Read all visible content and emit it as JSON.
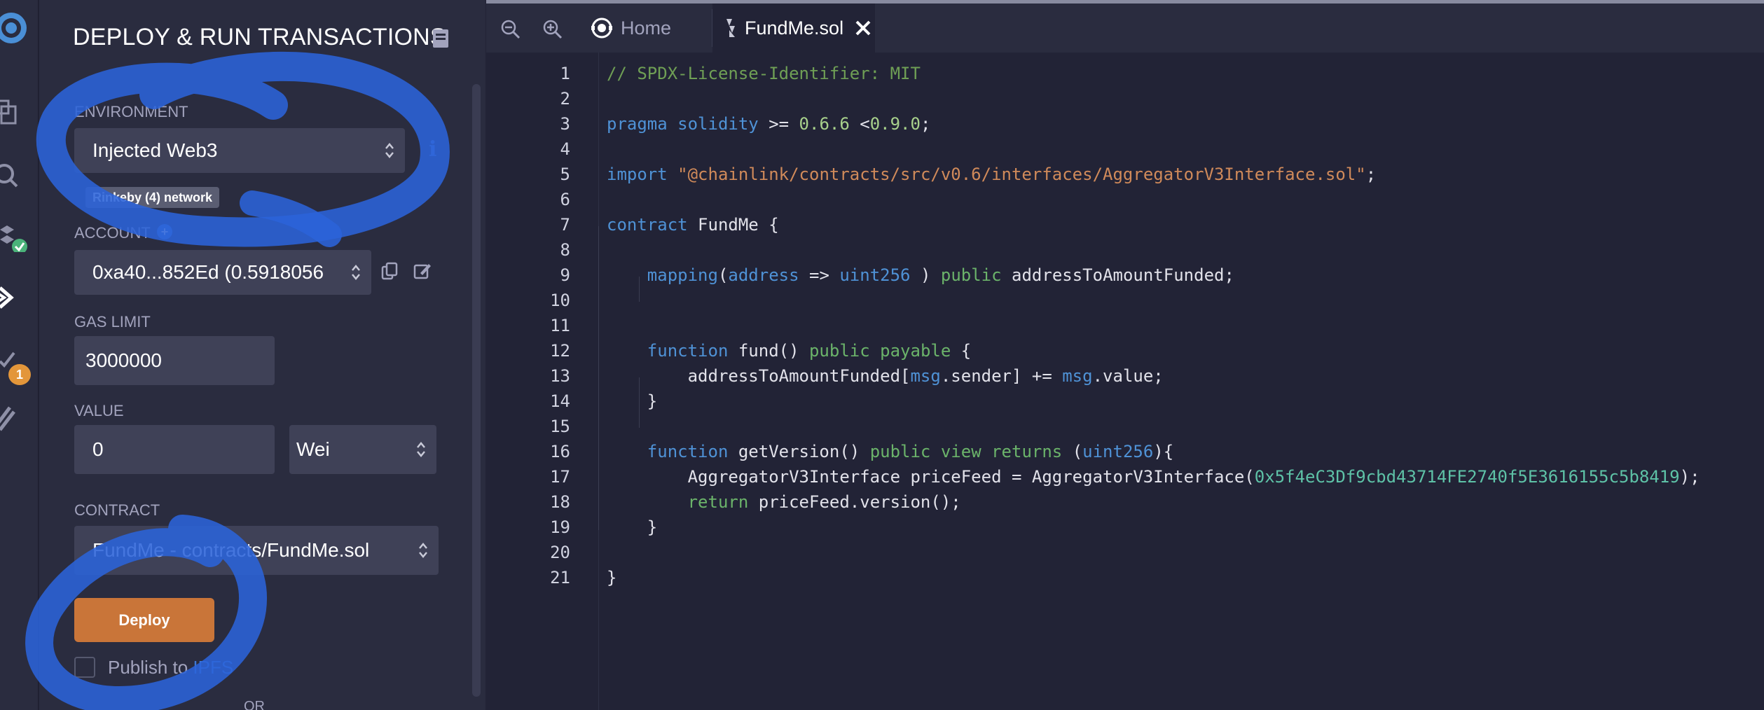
{
  "panel": {
    "title": "DEPLOY & RUN TRANSACTIONS",
    "environment": {
      "label": "ENVIRONMENT",
      "value": "Injected Web3",
      "network_tooltip": "Rinkeby (4) network"
    },
    "account": {
      "label": "ACCOUNT",
      "value": "0xa40...852Ed (0.5918056"
    },
    "gas_limit": {
      "label": "GAS LIMIT",
      "value": "3000000"
    },
    "value": {
      "label": "VALUE",
      "amount": "0",
      "unit": "Wei"
    },
    "contract": {
      "label": "CONTRACT",
      "value": "FundMe - contracts/FundMe.sol"
    },
    "deploy_label": "Deploy",
    "publish_prefix": "Publish to ",
    "publish_link": "IPFS",
    "or_label": "OR"
  },
  "rail": {
    "badge_count": "1"
  },
  "editor": {
    "tabs": [
      {
        "label": "Home",
        "icon": "remix-logo-icon"
      },
      {
        "label": "FundMe.sol",
        "icon": "solidity-file-icon"
      }
    ],
    "code_lines": [
      [
        {
          "t": "// SPDX-License-Identifier: MIT",
          "c": "com"
        }
      ],
      [],
      [
        {
          "t": "pragma",
          "c": "kw"
        },
        {
          "t": " "
        },
        {
          "t": "solidity",
          "c": "kw"
        },
        {
          "t": " >= "
        },
        {
          "t": "0.6.6",
          "c": "num"
        },
        {
          "t": " <"
        },
        {
          "t": "0.9.0",
          "c": "num"
        },
        {
          "t": ";"
        }
      ],
      [],
      [
        {
          "t": "import",
          "c": "kw"
        },
        {
          "t": " "
        },
        {
          "t": "\"@chainlink/contracts/src/v0.6/interfaces/AggregatorV3Interface.sol\"",
          "c": "str"
        },
        {
          "t": ";"
        }
      ],
      [],
      [
        {
          "t": "contract",
          "c": "kw"
        },
        {
          "t": " FundMe {"
        }
      ],
      [],
      [
        {
          "t": "    "
        },
        {
          "t": "mapping",
          "c": "kw"
        },
        {
          "t": "("
        },
        {
          "t": "address",
          "c": "type"
        },
        {
          "t": " => "
        },
        {
          "t": "uint256",
          "c": "type"
        },
        {
          "t": " ) "
        },
        {
          "t": "public",
          "c": "kw2"
        },
        {
          "t": " addressToAmountFunded;"
        }
      ],
      [],
      [],
      [
        {
          "t": "    "
        },
        {
          "t": "function",
          "c": "kw"
        },
        {
          "t": " fund() "
        },
        {
          "t": "public",
          "c": "kw2"
        },
        {
          "t": " "
        },
        {
          "t": "payable",
          "c": "kw2"
        },
        {
          "t": " {"
        }
      ],
      [
        {
          "t": "        addressToAmountFunded["
        },
        {
          "t": "msg",
          "c": "kw"
        },
        {
          "t": ".sender] += "
        },
        {
          "t": "msg",
          "c": "kw"
        },
        {
          "t": ".value;"
        }
      ],
      [
        {
          "t": "    }"
        }
      ],
      [],
      [
        {
          "t": "    "
        },
        {
          "t": "function",
          "c": "kw"
        },
        {
          "t": " getVersion() "
        },
        {
          "t": "public",
          "c": "kw2"
        },
        {
          "t": " "
        },
        {
          "t": "view",
          "c": "kw2"
        },
        {
          "t": " "
        },
        {
          "t": "returns",
          "c": "kw2"
        },
        {
          "t": " ("
        },
        {
          "t": "uint256",
          "c": "type"
        },
        {
          "t": "){"
        }
      ],
      [
        {
          "t": "        AggregatorV3Interface priceFeed = AggregatorV3Interface("
        },
        {
          "t": "0x5f4eC3Df9cbd43714FE2740f5E3616155c5b8419",
          "c": "hex"
        },
        {
          "t": ");"
        }
      ],
      [
        {
          "t": "        "
        },
        {
          "t": "return",
          "c": "kw2"
        },
        {
          "t": " priceFeed.version();"
        }
      ],
      [
        {
          "t": "    }"
        }
      ],
      [],
      [
        {
          "t": "}"
        }
      ]
    ]
  },
  "colors": {
    "accent_orange": "#c97539",
    "scribble_blue": "#2b63d9",
    "badge_orange": "#e3963a"
  }
}
